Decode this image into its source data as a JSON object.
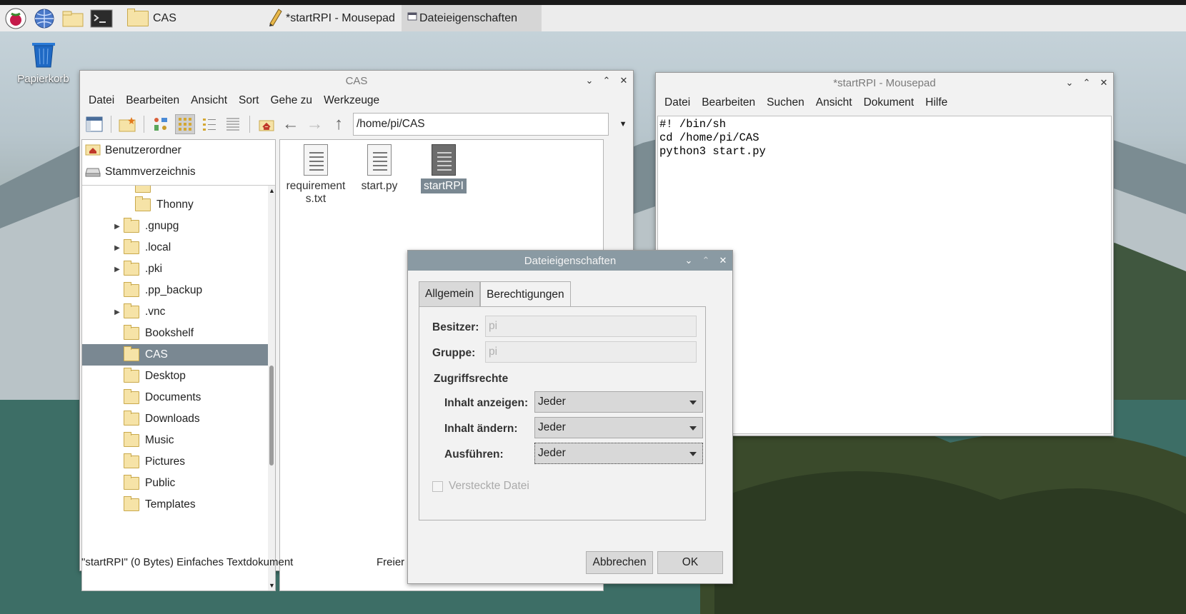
{
  "taskbar": {
    "tasks": [
      {
        "label": "CAS"
      },
      {
        "label": "*startRPI - Mousepad"
      },
      {
        "label": "Dateieigenschaften"
      }
    ]
  },
  "desktop": {
    "trash_label": "Papierkorb"
  },
  "file_manager": {
    "title": "CAS",
    "menu": [
      "Datei",
      "Bearbeiten",
      "Ansicht",
      "Sort",
      "Gehe zu",
      "Werkzeuge"
    ],
    "path": "/home/pi/CAS",
    "places": [
      "Benutzerordner",
      "Stammverzeichnis"
    ],
    "tree": [
      ".gnupg",
      ".local",
      ".pki",
      ".pp_backup",
      ".vnc",
      "Bookshelf",
      "CAS",
      "Desktop",
      "Documents",
      "Downloads",
      "Music",
      "Pictures",
      "Public",
      "Templates"
    ],
    "tree_partial_top": "Thonny",
    "files": [
      "requirements.txt",
      "start.py",
      "startRPI"
    ],
    "file1_line1": "requirement",
    "file1_line2": "s.txt",
    "status_left": "\"startRPI\" (0 Bytes) Einfaches Textdokument",
    "status_right": "Freier"
  },
  "mousepad": {
    "title": "*startRPI - Mousepad",
    "menu": [
      "Datei",
      "Bearbeiten",
      "Suchen",
      "Ansicht",
      "Dokument",
      "Hilfe"
    ],
    "lines": [
      "#! /bin/sh",
      "cd /home/pi/CAS",
      "python3 start.py"
    ]
  },
  "dialog": {
    "title": "Dateieigenschaften",
    "tabs": [
      "Allgemein",
      "Berechtigungen"
    ],
    "owner_label": "Besitzer:",
    "owner_value": "pi",
    "group_label": "Gruppe:",
    "group_value": "pi",
    "section": "Zugriffsrechte",
    "view_label": "Inhalt anzeigen:",
    "view_value": "Jeder",
    "change_label": "Inhalt ändern:",
    "change_value": "Jeder",
    "exec_label": "Ausführen:",
    "exec_value": "Jeder",
    "hidden_label": "Versteckte Datei",
    "cancel": "Abbrechen",
    "ok": "OK"
  }
}
